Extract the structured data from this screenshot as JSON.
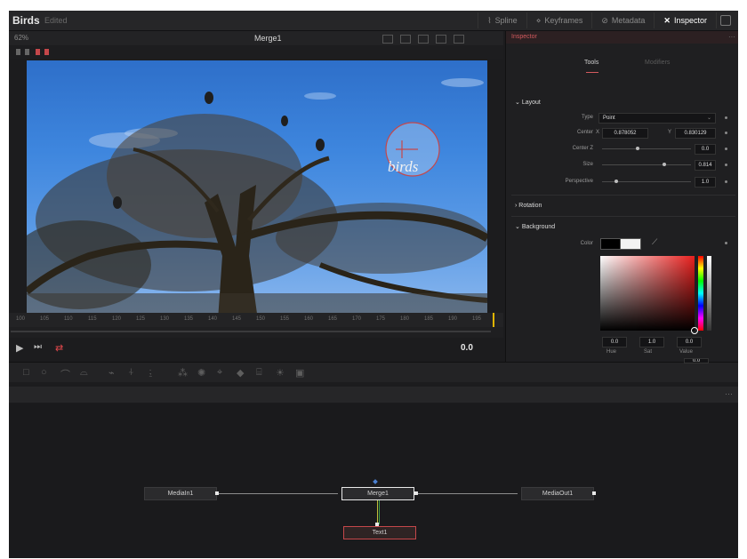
{
  "app": {
    "title": "Birds",
    "status": "Edited"
  },
  "topnav": [
    {
      "label": "Spline",
      "icon": "spline-icon"
    },
    {
      "label": "Keyframes",
      "icon": "keyframes-icon"
    },
    {
      "label": "Metadata",
      "icon": "metadata-icon"
    },
    {
      "label": "Inspector",
      "icon": "inspector-icon",
      "active": true
    }
  ],
  "viewer": {
    "zoom": "62%",
    "name": "Merge1",
    "overlay_text": "birds",
    "timeline_ticks": [
      "100",
      "105",
      "110",
      "115",
      "120",
      "125",
      "130",
      "135",
      "140",
      "145",
      "150",
      "155",
      "160",
      "165",
      "170",
      "175",
      "180",
      "185",
      "190",
      "195"
    ],
    "timecode": "0.0"
  },
  "inspector": {
    "header": "Inspector",
    "tabs": [
      "Tools",
      "Modifiers"
    ],
    "sections": {
      "layout": "Layout",
      "rotation": "Rotation",
      "background": "Background"
    },
    "params": {
      "type_label": "Type",
      "type_value": "Point",
      "center_label": "Center",
      "center_x": "0.878052",
      "center_y": "0.830129",
      "center_x_label": "X",
      "center_y_label": "Y",
      "center2_label": "Center Z",
      "center2_value": "0.0",
      "size_label": "Size",
      "size_value": "0.814",
      "perspective_label": "Perspective",
      "perspective_value": "1.0",
      "color_label": "Color"
    },
    "color_values": [
      {
        "value": "0.0",
        "label": "Hue"
      },
      {
        "value": "1.0",
        "label": "Sat"
      },
      {
        "value": "0.0",
        "label": "Value"
      }
    ],
    "partial_value": "0.0"
  },
  "nodes": {
    "mediain": "MediaIn1",
    "merge": "Merge1",
    "mediaout": "MediaOut1",
    "text": "Text1"
  },
  "colors": {
    "accent": "#d35a5e",
    "panel": "#1c1c1e",
    "sky": "#3e86de"
  }
}
